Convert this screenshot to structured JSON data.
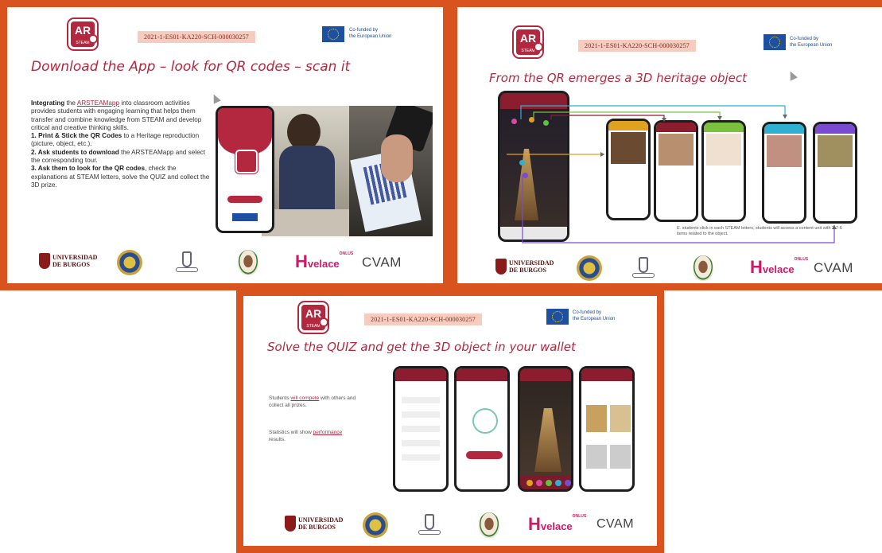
{
  "slides": [
    {
      "project_code": "2021-1-ES01-KA220-SCH-000030257",
      "eu_label_line1": "Co-funded by",
      "eu_label_line2": "the European Union",
      "title": "Download the App – look for QR codes – scan it",
      "body": {
        "intro_bold": "Integrating",
        "intro_pre": " the ",
        "intro_link": "ARSTEAMapp",
        "intro_post": " into classroom activities provides students with engaging learning that helps them transfer and combine knowledge from STEAM and develop critical and creative thinking skills.",
        "step1_bold": "1. Print & Stick the QR Codes",
        "step1_rest": " to a Heritage reproduction (picture, object, etc.).",
        "step2_bold": "2. Ask students to download",
        "step2_rest": " the ARSTEAMapp and select the corresponding tour.",
        "step3_bold": "3. Ask them to look for the QR codes",
        "step3_rest": ", check the explanations at STEAM letters, solve the QUIZ and collect the 3D prize."
      }
    },
    {
      "project_code": "2021-1-ES01-KA220-SCH-000030257",
      "eu_label_line1": "Co-funded by",
      "eu_label_line2": "the European Union",
      "title": "From the QR emerges a 3D heritage object",
      "caption": "E. students click in each STEAM letters, students will access a content unit with 2-7-6 items related to the object."
    },
    {
      "project_code": "2021-1-ES01-KA220-SCH-000030257",
      "eu_label_line1": "Co-funded by",
      "eu_label_line2": "the European Union",
      "title": "Solve the QUIZ and get the 3D object in your wallet",
      "note1_pre": "Students ",
      "note1_link": "will compete",
      "note1_post": " with others and collect all prizes.",
      "note2_pre": "Statistics will show ",
      "note2_link": "performance",
      "note2_post": " results."
    }
  ],
  "logo": {
    "ar": "AR",
    "ar_sub": "STEAM"
  },
  "footer": {
    "ubu_line1": "UNIVERSIDAD",
    "ubu_line2": "DE BURGOS",
    "hvelace_h": "H",
    "hvelace_rest": "velace",
    "hvelace_tiny": "ONLUS",
    "cvam": "CVAM"
  },
  "colors": {
    "frame": "#d9531e",
    "brand": "#b3283f",
    "eu_blue": "#1d4fa3"
  }
}
